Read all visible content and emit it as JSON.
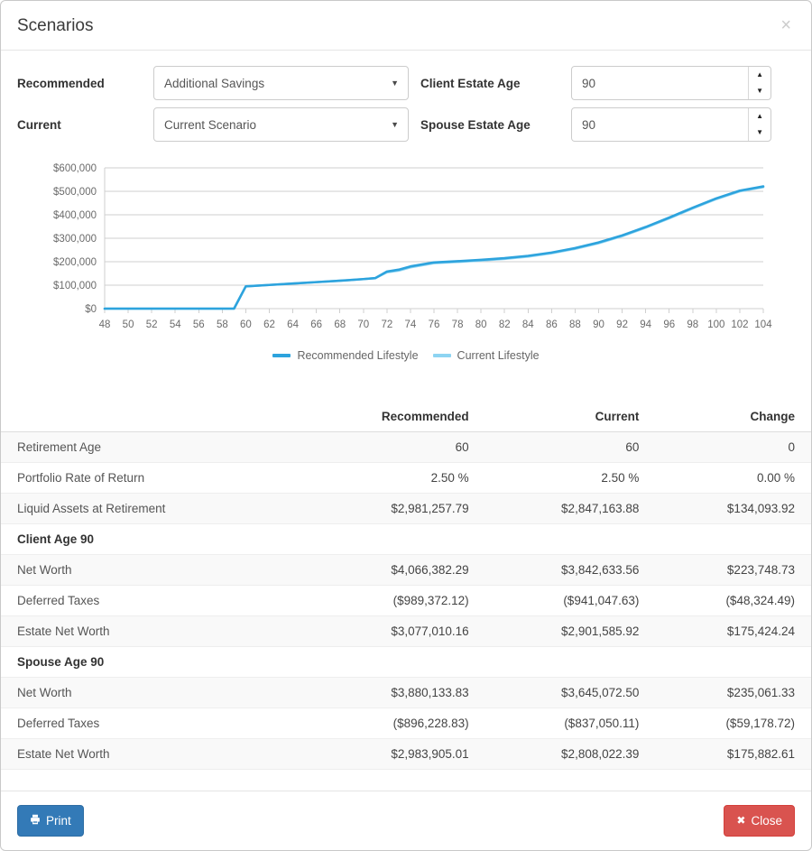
{
  "modal": {
    "title": "Scenarios",
    "close_icon": "close-icon",
    "close_glyph": "×"
  },
  "form": {
    "recommended_label": "Recommended",
    "recommended_value": "Additional Savings",
    "recommended_options": [
      "Additional Savings"
    ],
    "current_label": "Current",
    "current_value": "Current Scenario",
    "current_options": [
      "Current Scenario"
    ],
    "client_estate_age_label": "Client Estate Age",
    "client_estate_age_value": "90",
    "spouse_estate_age_label": "Spouse Estate Age",
    "spouse_estate_age_value": "90",
    "caret_glyph": "▼",
    "spin_up_glyph": "▲",
    "spin_down_glyph": "▼"
  },
  "chart_data": {
    "type": "line",
    "title": "",
    "xlabel": "",
    "ylabel": "",
    "xlim": [
      48,
      104
    ],
    "ylim": [
      0,
      600000
    ],
    "grid": true,
    "legend_position": "bottom",
    "xticks": [
      48,
      50,
      52,
      54,
      56,
      58,
      60,
      62,
      64,
      66,
      68,
      70,
      72,
      74,
      76,
      78,
      80,
      82,
      84,
      86,
      88,
      90,
      92,
      94,
      96,
      98,
      100,
      102,
      104
    ],
    "ytick_labels": [
      "$0",
      "$100,000",
      "$200,000",
      "$300,000",
      "$400,000",
      "$500,000",
      "$600,000"
    ],
    "yticks": [
      0,
      100000,
      200000,
      300000,
      400000,
      500000,
      600000
    ],
    "x": [
      48,
      50,
      52,
      54,
      56,
      58,
      59,
      60,
      62,
      64,
      66,
      68,
      70,
      71,
      72,
      73,
      74,
      76,
      78,
      80,
      82,
      84,
      86,
      88,
      90,
      92,
      94,
      96,
      98,
      100,
      102,
      104
    ],
    "series": [
      {
        "name": "Recommended Lifestyle",
        "color": "#2da3dd",
        "values": [
          0,
          0,
          0,
          0,
          0,
          0,
          0,
          95000,
          101000,
          107000,
          113000,
          119000,
          126000,
          130000,
          158000,
          166000,
          180000,
          197000,
          202000,
          208000,
          215000,
          225000,
          239000,
          258000,
          282000,
          312000,
          348000,
          388000,
          430000,
          470000,
          503000,
          521000
        ]
      },
      {
        "name": "Current Lifestyle",
        "color": "#8dd4f2",
        "values": [
          0,
          0,
          0,
          0,
          0,
          0,
          0,
          95000,
          101000,
          107000,
          113000,
          119000,
          126000,
          130000,
          155000,
          162000,
          176000,
          194000,
          199000,
          205000,
          212000,
          222000,
          236000,
          255000,
          279000,
          309000,
          345000,
          385000,
          427000,
          467000,
          500000,
          518000
        ]
      }
    ]
  },
  "table": {
    "headers": [
      "",
      "Recommended",
      "Current",
      "Change"
    ],
    "rows": [
      {
        "type": "data",
        "label": "Retirement Age",
        "recommended": "60",
        "current": "60",
        "change": "0"
      },
      {
        "type": "data",
        "label": "Portfolio Rate of Return",
        "recommended": "2.50 %",
        "current": "2.50 %",
        "change": "0.00 %"
      },
      {
        "type": "data",
        "label": "Liquid Assets at Retirement",
        "recommended": "$2,981,257.79",
        "current": "$2,847,163.88",
        "change": "$134,093.92"
      },
      {
        "type": "section",
        "label": "Client Age 90",
        "recommended": "",
        "current": "",
        "change": ""
      },
      {
        "type": "data",
        "label": "Net Worth",
        "recommended": "$4,066,382.29",
        "current": "$3,842,633.56",
        "change": "$223,748.73"
      },
      {
        "type": "data",
        "label": "Deferred Taxes",
        "recommended": "($989,372.12)",
        "current": "($941,047.63)",
        "change": "($48,324.49)"
      },
      {
        "type": "data",
        "label": "Estate Net Worth",
        "recommended": "$3,077,010.16",
        "current": "$2,901,585.92",
        "change": "$175,424.24"
      },
      {
        "type": "section",
        "label": "Spouse Age 90",
        "recommended": "",
        "current": "",
        "change": ""
      },
      {
        "type": "data",
        "label": "Net Worth",
        "recommended": "$3,880,133.83",
        "current": "$3,645,072.50",
        "change": "$235,061.33"
      },
      {
        "type": "data",
        "label": "Deferred Taxes",
        "recommended": "($896,228.83)",
        "current": "($837,050.11)",
        "change": "($59,178.72)"
      },
      {
        "type": "data",
        "label": "Estate Net Worth",
        "recommended": "$2,983,905.01",
        "current": "$2,808,022.39",
        "change": "$175,882.61"
      }
    ]
  },
  "footer": {
    "print_label": "Print",
    "print_icon": "printer-icon",
    "close_label": "Close",
    "close_icon": "x-mark-icon",
    "close_glyph": "✖"
  },
  "colors": {
    "primary": "#337ab7",
    "danger": "#d9534f",
    "series_recommended": "#2da3dd",
    "series_current": "#8dd4f2"
  }
}
